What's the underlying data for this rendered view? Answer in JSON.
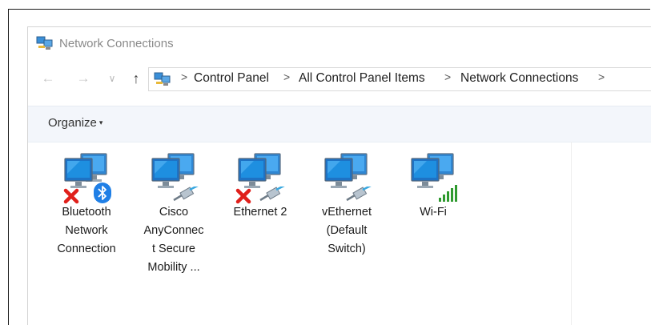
{
  "window": {
    "title": "Network Connections"
  },
  "nav": {
    "back_icon": "arrow-left-icon",
    "forward_icon": "arrow-right-icon",
    "recent_icon": "chevron-down-icon",
    "up_icon": "arrow-up-icon"
  },
  "address": {
    "breadcrumbs": [
      "Control Panel",
      "All Control Panel Items",
      "Network Connections"
    ],
    "separator": ">"
  },
  "toolbar": {
    "organize_label": "Organize",
    "organize_caret": "▾"
  },
  "connections": [
    {
      "label_lines": [
        "Bluetooth",
        "Network",
        "Connection"
      ],
      "icon": "network-monitors-icon",
      "status": "disconnected",
      "overlay": "bluetooth-icon"
    },
    {
      "label_lines": [
        "Cisco",
        "AnyConnec",
        "t Secure",
        "Mobility ..."
      ],
      "icon": "network-monitors-icon",
      "status": "enabled",
      "overlay": "ethernet-cable-icon"
    },
    {
      "label_lines": [
        "Ethernet 2"
      ],
      "icon": "network-monitors-icon",
      "status": "disconnected",
      "overlay": "ethernet-cable-icon"
    },
    {
      "label_lines": [
        "vEthernet",
        "(Default",
        "Switch)"
      ],
      "icon": "network-monitors-icon",
      "status": "enabled",
      "overlay": "ethernet-cable-icon"
    },
    {
      "label_lines": [
        "Wi-Fi"
      ],
      "icon": "network-monitors-icon",
      "status": "connected",
      "overlay": "wifi-signal-bars-icon"
    }
  ],
  "colors": {
    "toolbar_bg": "#f3f6fb",
    "monitor_blue": "#1e8fe0",
    "error_red": "#e0201b",
    "bluetooth_blue": "#1f7fe6",
    "signal_green": "#2f9a2f"
  }
}
